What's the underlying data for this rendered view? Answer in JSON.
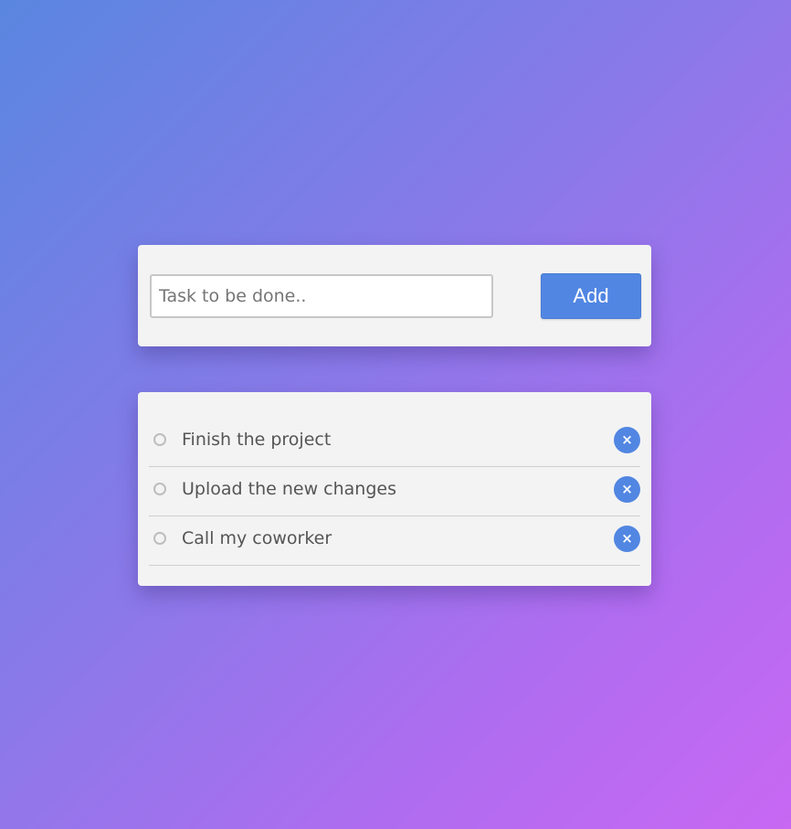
{
  "colors": {
    "accent": "#5186e2",
    "card_background": "#f3f3f3",
    "text": "#555555"
  },
  "input": {
    "placeholder": "Task to be done..",
    "value": ""
  },
  "add_button": {
    "label": "Add"
  },
  "tasks": [
    {
      "text": "Finish the project",
      "done": false,
      "delete_icon": "×"
    },
    {
      "text": "Upload the new changes",
      "done": false,
      "delete_icon": "×"
    },
    {
      "text": "Call my coworker",
      "done": false,
      "delete_icon": "×"
    }
  ]
}
